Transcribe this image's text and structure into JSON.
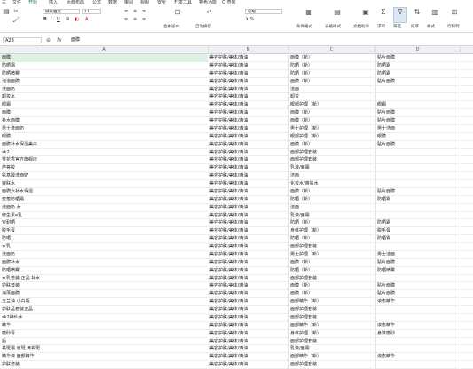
{
  "menu_tabs": [
    "三",
    "文件",
    "开始",
    "插入",
    "页面布局",
    "公式",
    "数据",
    "审阅",
    "视图",
    "安全",
    "开发工具",
    "特色功能",
    "Q 查找"
  ],
  "ribbon": {
    "font_name": "微软雅黑",
    "font_size": "11",
    "number_format": "常规",
    "buttons": [
      "合并居中",
      "自动换行",
      "条件格式",
      "表格样式",
      "文档助手",
      "求和",
      "筛选",
      "排序",
      "格式",
      "行和列"
    ]
  },
  "formula_bar": {
    "cell_ref": "A28",
    "fx_label": "fx",
    "value": "面膜"
  },
  "columns": [
    "A",
    "B",
    "C",
    "D"
  ],
  "rows": [
    [
      "面膜",
      "美容护肤/美体/精油",
      "面膜（新）",
      "贴片面膜"
    ],
    [
      "防晒霜",
      "美容护肤/美体/精油",
      "防晒（新）",
      "防晒霜"
    ],
    [
      "防晒喷雾",
      "美容护肤/美体/精油",
      "防晒（新）",
      "防晒霜"
    ],
    [
      "泡泡面膜",
      "美容护肤/美体/精油",
      "面膜（新）",
      "贴片面膜"
    ],
    [
      "洗面奶",
      "美容护肤/美体/精油",
      "洁面",
      ""
    ],
    [
      "卸妆水",
      "美容护肤/美体/精油",
      "卸妆",
      ""
    ],
    [
      "眼霜",
      "美容护肤/美体/精油",
      "眼部护理（新）",
      "眼霜"
    ],
    [
      "面膜",
      "美容护肤/美体/精油",
      "面膜（新）",
      "贴片面膜"
    ],
    [
      "补水面膜",
      "美容护肤/美体/精油",
      "面膜（新）",
      "贴片面膜"
    ],
    [
      "男士洗面奶",
      "美容护肤/美体/精油",
      "男士护理（新）",
      "男士洁面"
    ],
    [
      "眼膜",
      "美容护肤/美体/精油",
      "眼部护理（新）",
      "眼膜"
    ],
    [
      "面膜补水保湿美白",
      "美容护肤/美体/精油",
      "面膜（新）",
      "贴片面膜"
    ],
    [
      "sk2",
      "美容护肤/美体/精油",
      "面部护理套装",
      ""
    ],
    [
      "雪花秀官方旗舰店",
      "美容护肤/美体/精油",
      "面部护理套装",
      ""
    ],
    [
      "芦荟胶",
      "美容护肤/美体/精油",
      "乳液/面霜",
      ""
    ],
    [
      "氨基酸洗面奶",
      "美容护肤/美体/精油",
      "洁面",
      ""
    ],
    [
      "爽肤水",
      "美容护肤/美体/精油",
      "化妆水/爽肤水",
      ""
    ],
    [
      "面膜女补水保湿",
      "美容护肤/美体/精油",
      "面膜（新）",
      "贴片面膜"
    ],
    [
      "蜜葱防晒霜",
      "美容护肤/美体/精油",
      "防晒（新）",
      "防晒霜"
    ],
    [
      "洗面奶 女",
      "美容护肤/美体/精油",
      "洁面",
      ""
    ],
    [
      "修生素e乳",
      "美容护肤/美体/精油",
      "乳液/面霜",
      ""
    ],
    [
      "安耐晒",
      "美容护肤/美体/精油",
      "防晒（新）",
      "防晒霜"
    ],
    [
      "脱毛膏",
      "美容护肤/美体/精油",
      "身体护理（新）",
      "脱毛膏"
    ],
    [
      "防晒",
      "美容护肤/美体/精油",
      "防晒（新）",
      "防晒霜"
    ],
    [
      "水乳",
      "美容护肤/美体/精油",
      "面部护理套装",
      ""
    ],
    [
      "洗面奶",
      "美容护肤/美体/精油",
      "男士护理（新）",
      "男士洁面"
    ],
    [
      "面膜补水",
      "美容护肤/美体/精油",
      "面膜（新）",
      "贴片面膜"
    ],
    [
      "防晒喷雾",
      "美容护肤/美体/精油",
      "防晒（新）",
      "防晒喷雾"
    ],
    [
      "水乳套装 正品 补水",
      "美容护肤/美体/精油",
      "面部护理套装",
      ""
    ],
    [
      "护肤套装",
      "美容护肤/美体/精油",
      "面膜（新）",
      "贴片面膜"
    ],
    [
      "海藻面膜",
      "美容护肤/美体/精油",
      "面膜（新）",
      "贴片面膜"
    ],
    [
      "玉兰油 小白瓶",
      "美容护肤/美体/精油",
      "面部精华（新）",
      "液态精华"
    ],
    [
      "护肤品套装正品",
      "美容护肤/美体/精油",
      "面部护理套装",
      ""
    ],
    [
      "sk2神仙水",
      "美容护肤/美体/精油",
      "面部护理套装",
      ""
    ],
    [
      "精华",
      "美容护肤/美体/精油",
      "面部精华（新）",
      "液态精华"
    ],
    [
      "磨砂膏",
      "美容护肤/美体/精油",
      "身体护理（新）",
      "身体磨砂"
    ],
    [
      "后",
      "美容护肤/美体/精油",
      "面部护理套装",
      ""
    ],
    [
      "祛斑霜 雀斑 黄褐斑",
      "美容护肤/美体/精油",
      "乳液/面霜",
      ""
    ],
    [
      "精华液 面部精华",
      "美容护肤/美体/精油",
      "面部精华（新）",
      "液态精华"
    ],
    [
      "护肤套装",
      "美容护肤/美体/精油",
      "面部护理套装",
      ""
    ]
  ]
}
